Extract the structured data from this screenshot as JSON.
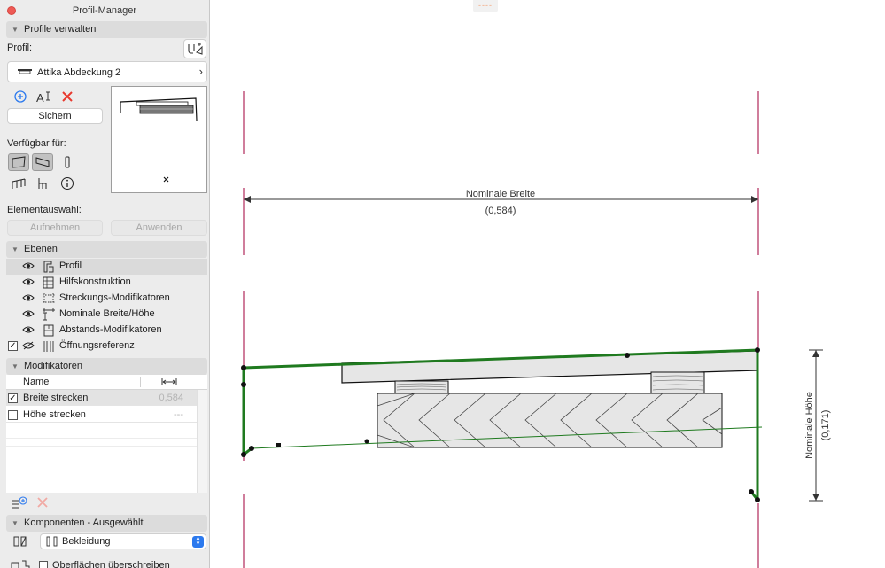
{
  "window": {
    "title": "Profil-Manager"
  },
  "sections": {
    "manage": "Profile verwalten",
    "layers": "Ebenen",
    "modifiers": "Modifikatoren",
    "components": "Komponenten - Ausgewählt"
  },
  "profile": {
    "label": "Profil:",
    "current_name": "Attika Abdeckung 2",
    "save_button": "Sichern",
    "available_label": "Verfügbar für:"
  },
  "element_selection": {
    "label": "Elementauswahl:",
    "pick_button": "Aufnehmen",
    "apply_button": "Anwenden"
  },
  "layers": [
    {
      "label": "Profil",
      "visible": true,
      "icon": "profile-layer-icon",
      "selected": true
    },
    {
      "label": "Hilfskonstruktion",
      "visible": true,
      "icon": "construction-layer-icon"
    },
    {
      "label": "Streckungs-Modifikatoren",
      "visible": true,
      "icon": "stretch-layer-icon"
    },
    {
      "label": "Nominale Breite/Höhe",
      "visible": true,
      "icon": "nominal-layer-icon"
    },
    {
      "label": "Abstands-Modifikatoren",
      "visible": true,
      "icon": "offset-layer-icon"
    },
    {
      "label": "Öffnungsreferenz",
      "visible": false,
      "checked": true,
      "icon": "opening-layer-icon"
    }
  ],
  "modifiers": {
    "column_name": "Name",
    "rows": [
      {
        "name": "Breite strecken",
        "checked": true,
        "value": "0,584",
        "selected": true
      },
      {
        "name": "Höhe strecken",
        "checked": false,
        "value": "---"
      }
    ]
  },
  "components": {
    "material": "Bekleidung",
    "override_label": "Oberflächen überschreiben"
  },
  "canvas": {
    "top_tab": "----",
    "width_label": "Nominale Breite",
    "width_value": "(0,584)",
    "height_label": "Nominale Höhe",
    "height_value": "(0,171)"
  },
  "colors": {
    "guide_line": "#b0285a",
    "profile_outline": "#1f7a1f",
    "accent": "#2b79ee",
    "delete": "#e8392e"
  }
}
